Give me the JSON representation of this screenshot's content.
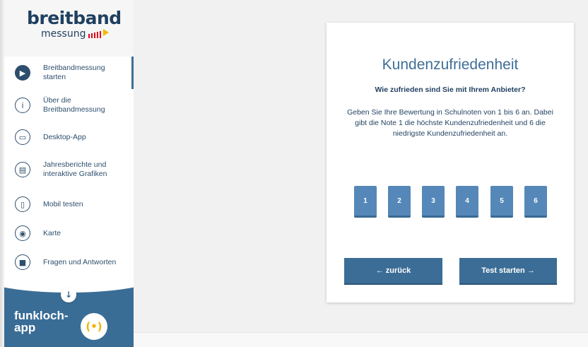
{
  "sidebar": {
    "logo": {
      "main": "breitband",
      "sub": "messung"
    },
    "items": [
      {
        "label": "Breitbandmessung starten",
        "icon": "play-icon",
        "glyph": "▶",
        "active": true
      },
      {
        "label": "Über die Breitbandmessung",
        "icon": "info-icon",
        "glyph": "i",
        "active": false
      },
      {
        "label": "Desktop-App",
        "icon": "desktop-icon",
        "glyph": "▭",
        "active": false
      },
      {
        "label": "Jahresberichte und interaktive Grafiken",
        "icon": "chart-icon",
        "glyph": "▤",
        "active": false
      },
      {
        "label": "Mobil testen",
        "icon": "mobile-icon",
        "glyph": "▯",
        "active": false
      },
      {
        "label": "Karte",
        "icon": "map-pin-icon",
        "glyph": "◉",
        "active": false
      },
      {
        "label": "Fragen und Antworten",
        "icon": "chat-icon",
        "glyph": "■",
        "active": false
      }
    ],
    "promo": {
      "text": "funkloch-app",
      "down_icon": "arrow-down-icon",
      "down_glyph": "↓",
      "app_icon": "signal-icon",
      "app_glyph": "(•)"
    }
  },
  "card": {
    "title": "Kundenzufriedenheit",
    "question": "Wie zufrieden sind Sie mit Ihrem Anbieter?",
    "text": "Geben Sie Ihre Bewertung in Schulnoten von 1 bis 6 an. Dabei gibt die Note 1 die höchste Kundenzufriedenheit und 6 die niedrigste Kundenzufriedenheit an.",
    "grades": [
      "1",
      "2",
      "3",
      "4",
      "5",
      "6"
    ],
    "back_label": "← zurück",
    "start_label": "Test starten →"
  },
  "colors": {
    "accent": "#3c6d96",
    "grade": "#5588b8",
    "text": "#1f3f5f",
    "background": "#f1f1f1"
  }
}
